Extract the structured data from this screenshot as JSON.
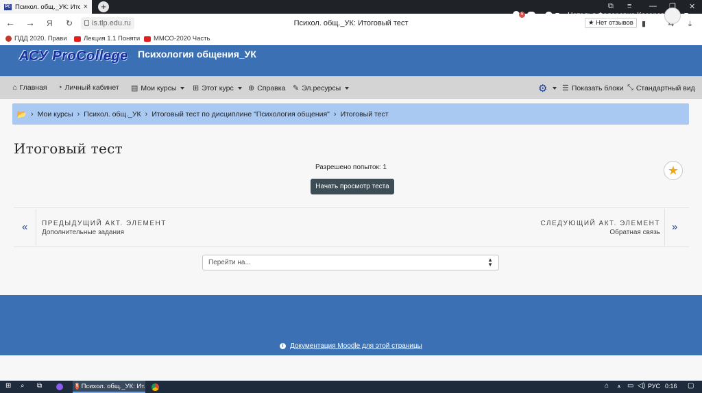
{
  "browser": {
    "tab_title": "Психол. общ._УК: Итого",
    "tab_close": "×",
    "new_tab": "+",
    "favicon_text": "РС",
    "url": "is.tlp.edu.ru",
    "page_title": "Психол. общ._УК: Итоговый тест",
    "reviews_label": "★ Нет отзывов",
    "yandex_label": "Я",
    "bookmarks": [
      {
        "label": "ПДД 2020. Прави",
        "color": "#c0392b"
      },
      {
        "label": "Лекция 1.1 Поняти",
        "color": "#e02020"
      },
      {
        "label": "ММСО-2020 Часть",
        "color": "#e02020"
      }
    ]
  },
  "header": {
    "logo": "АСУ ProCollege",
    "course_title": "Психология общения_УК",
    "notification_count": "5",
    "user_name": "Наталья Федоровна Косарева"
  },
  "menu": {
    "items": [
      {
        "label": "Главная",
        "icon": "home-icon",
        "glyph": "⌂"
      },
      {
        "label": "Личный кабинет",
        "icon": "dashboard-icon",
        "glyph": "◔"
      },
      {
        "label": "Мои курсы",
        "icon": "briefcase-icon",
        "glyph": "▤"
      },
      {
        "label": "Этот курс",
        "icon": "sitemap-icon",
        "glyph": "⊞"
      },
      {
        "label": "Справка",
        "icon": "lifebuoy-icon",
        "glyph": "⊕"
      },
      {
        "label": "Эл.ресурсы",
        "icon": "wrench-icon",
        "glyph": "✎"
      }
    ],
    "show_blocks": "Показать блоки",
    "standard_view": "Стандартный вид"
  },
  "breadcrumb": [
    "Мои курсы",
    "Психол. общ._УК",
    "Итоговый тест по дисциплине \"Психология общения\"",
    "Итоговый тест"
  ],
  "main": {
    "heading": "Итоговый тест",
    "attempts": "Разрешено попыток: 1",
    "preview_button": "Начать просмотр теста",
    "prev_label": "ПРЕДЫДУЩИЙ АКТ. ЭЛЕМЕНТ",
    "prev_name": "Дополнительные задания",
    "next_label": "СЛЕДУЮЩИЙ АКТ. ЭЛЕМЕНТ",
    "next_name": "Обратная связь",
    "jump_placeholder": "Перейти на..."
  },
  "footer": {
    "doc_link": "Документация Moodle для этой страницы"
  },
  "taskbar": {
    "app_label": "Психол. общ._УК: Ит...",
    "lang": "РУС",
    "time": "0:16"
  },
  "colors": {
    "header_blue": "#3b70b5",
    "breadcrumb_bg": "#a9c9f3",
    "button_dark": "#3c4d55",
    "star": "#f0a81a"
  }
}
